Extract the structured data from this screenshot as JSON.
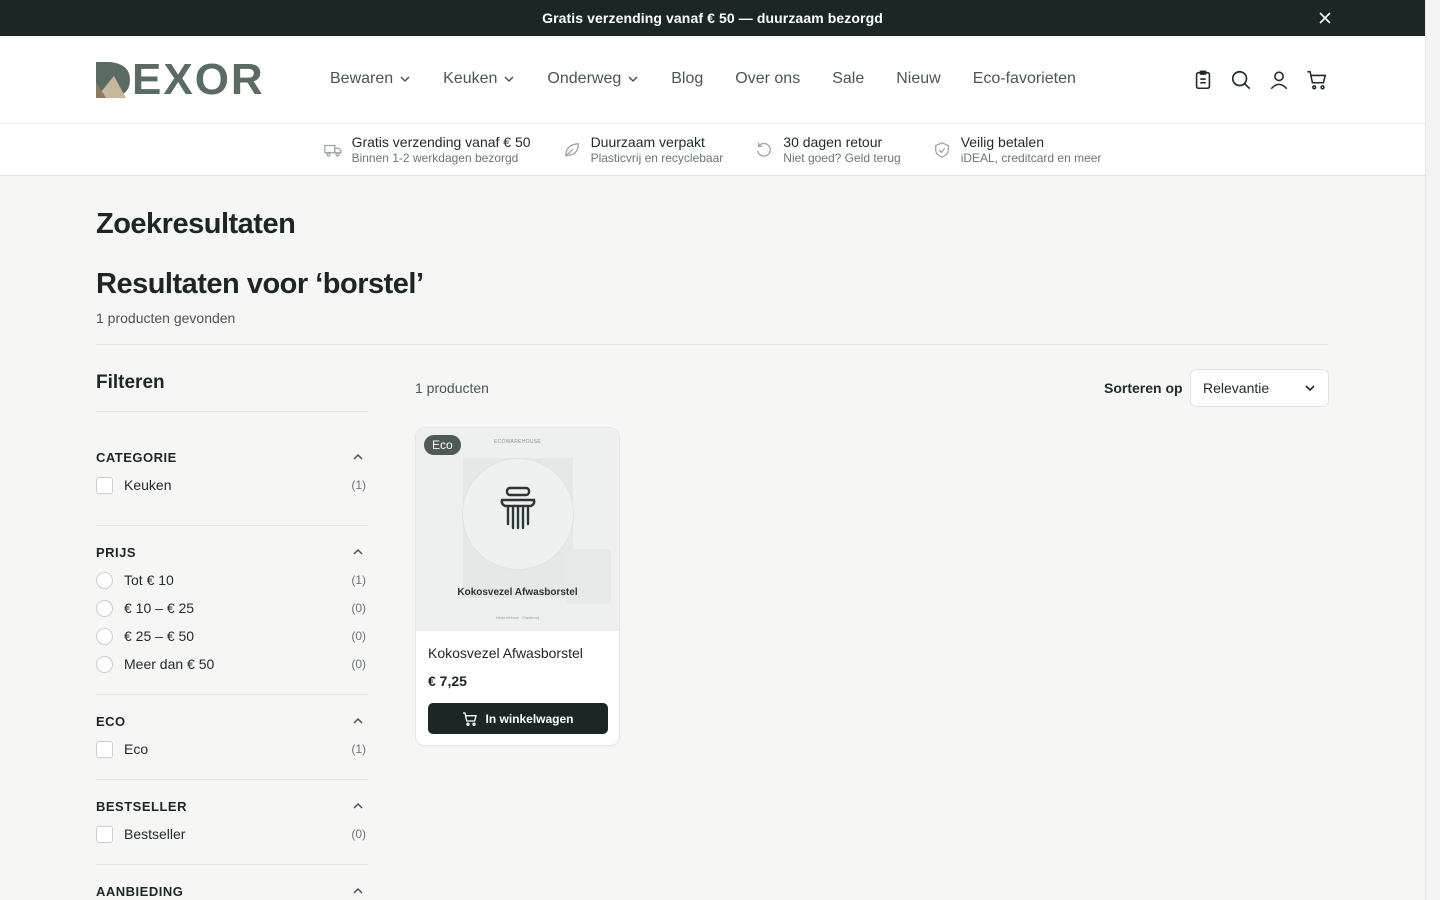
{
  "announcement": {
    "text": "Gratis verzending vanaf € 50 — duurzaam bezorgd",
    "close_icon": "close-icon"
  },
  "header": {
    "logo_text": "EXOR",
    "nav": [
      {
        "label": "Bewaren",
        "has_dropdown": true
      },
      {
        "label": "Keuken",
        "has_dropdown": true
      },
      {
        "label": "Onderweg",
        "has_dropdown": true
      },
      {
        "label": "Blog",
        "has_dropdown": false
      },
      {
        "label": "Over ons",
        "has_dropdown": false
      },
      {
        "label": "Sale",
        "has_dropdown": false
      },
      {
        "label": "Nieuw",
        "has_dropdown": false
      },
      {
        "label": "Eco-favorieten",
        "has_dropdown": false
      }
    ],
    "icons": [
      "clipboard-icon",
      "search-icon",
      "user-icon",
      "cart-icon"
    ]
  },
  "usps": [
    {
      "icon": "truck-icon",
      "title": "Gratis verzending vanaf € 50",
      "sub": "Binnen 1-2 werkdagen bezorgd"
    },
    {
      "icon": "leaf-icon",
      "title": "Duurzaam verpakt",
      "sub": "Plasticvrij en recyclebaar"
    },
    {
      "icon": "return-icon",
      "title": "30 dagen retour",
      "sub": "Niet goed? Geld terug"
    },
    {
      "icon": "shield-icon",
      "title": "Veilig betalen",
      "sub": "iDEAL, creditcard en meer"
    }
  ],
  "page": {
    "title": "Zoekresultaten",
    "results_title": "Resultaten voor ‘borstel’",
    "results_count": "1 producten gevonden"
  },
  "filters": {
    "title": "Filteren",
    "groups": [
      {
        "name": "CATEGORIE",
        "type": "checkbox",
        "options": [
          {
            "label": "Keuken",
            "count": "(1)"
          }
        ]
      },
      {
        "name": "PRIJS",
        "type": "radio",
        "options": [
          {
            "label": "Tot € 10",
            "count": "(1)"
          },
          {
            "label": "€ 10 – € 25",
            "count": "(0)"
          },
          {
            "label": "€ 25 – € 50",
            "count": "(0)"
          },
          {
            "label": "Meer dan € 50",
            "count": "(0)"
          }
        ]
      },
      {
        "name": "ECO",
        "type": "checkbox",
        "options": [
          {
            "label": "Eco",
            "count": "(1)"
          }
        ]
      },
      {
        "name": "BESTSELLER",
        "type": "checkbox",
        "options": [
          {
            "label": "Bestseller",
            "count": "(0)"
          }
        ]
      },
      {
        "name": "AANBIEDING",
        "type": "checkbox",
        "options": []
      }
    ]
  },
  "toolbar": {
    "count": "1 producten",
    "sort_label": "Sorteren op",
    "sort_value": "Relevantie"
  },
  "products": [
    {
      "badge": "Eco",
      "image_brand": "ECOWAREHOUSE",
      "image_name": "Kokosvezel Afwasborstel",
      "image_small": "Herbruikbaar · Plasticvrij",
      "title": "Kokosvezel Afwasborstel",
      "price": "€ 7,25",
      "button_label": "In winkelwagen"
    }
  ],
  "colors": {
    "dark": "#1c2626",
    "logo": "#5a6b62",
    "badge": "#4d5a55",
    "background": "#f6f6f5"
  }
}
